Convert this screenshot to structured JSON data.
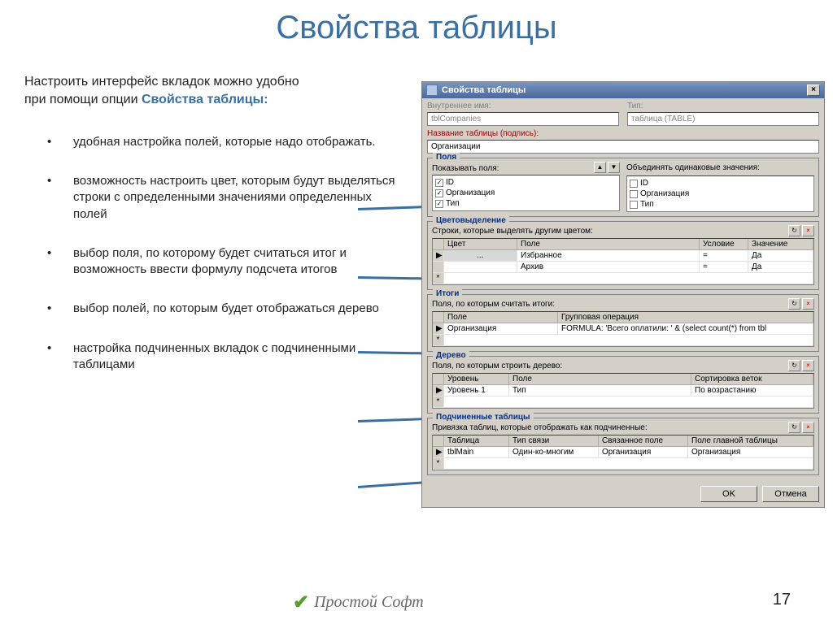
{
  "slide": {
    "title": "Свойства таблицы",
    "intro_line1": "Настроить интерфейс вкладок можно удобно",
    "intro_line2_prefix": "при помощи опции ",
    "intro_line2_em": "Свойства таблицы:",
    "bullets": [
      "удобная настройка полей, которые надо отображать.",
      "возможность настроить цвет, которым будут выделяться строки с определенными значениями определенных полей",
      "выбор поля, по которому будет считаться итог и возможность ввести формулу подсчета итогов",
      "выбор полей, по которым будет отображаться дерево",
      "настройка подчиненных вкладок с подчиненными таблицами"
    ],
    "page_number": "17",
    "footer": "Простой Софт"
  },
  "dialog": {
    "title": "Свойства таблицы",
    "close": "×",
    "internal_name_label": "Внутреннее имя:",
    "internal_name_value": "tblCompanies",
    "type_label": "Тип:",
    "type_value": "таблица (TABLE)",
    "caption_label": "Название таблицы (подпись):",
    "caption_value": "Организации",
    "groups": {
      "fields": {
        "title": "Поля",
        "show_label": "Показывать поля:",
        "merge_label": "Объединять одинаковые значения:",
        "show_items": [
          {
            "checked": true,
            "label": "ID"
          },
          {
            "checked": true,
            "label": "Организация"
          },
          {
            "checked": true,
            "label": "Тип"
          }
        ],
        "merge_items": [
          {
            "checked": false,
            "label": "ID"
          },
          {
            "checked": false,
            "label": "Организация"
          },
          {
            "checked": false,
            "label": "Тип"
          }
        ]
      },
      "colors": {
        "title": "Цветовыделение",
        "label": "Строки, которые выделять другим цветом:",
        "cols": [
          "Цвет",
          "Поле",
          "Условие",
          "Значение"
        ],
        "rows": [
          [
            "",
            "Избранное",
            "=",
            "Да"
          ],
          [
            "",
            "Архив",
            "=",
            "Да"
          ]
        ]
      },
      "totals": {
        "title": "Итоги",
        "label": "Поля, по которым считать итоги:",
        "cols": [
          "Поле",
          "Групповая операция"
        ],
        "rows": [
          [
            "Организация",
            "FORMULA: 'Всего оплатили: ' & (select count(*) from tbl"
          ]
        ]
      },
      "tree": {
        "title": "Дерево",
        "label": "Поля, по которым строить дерево:",
        "cols": [
          "Уровень",
          "Поле",
          "Сортировка веток"
        ],
        "rows": [
          [
            "Уровень 1",
            "Тип",
            "По возрастанию"
          ]
        ]
      },
      "subtables": {
        "title": "Подчиненные таблицы",
        "label": "Привязка таблиц, которые отображать как подчиненные:",
        "cols": [
          "Таблица",
          "Тип связи",
          "Связанное поле",
          "Поле главной таблицы"
        ],
        "rows": [
          [
            "tblMain",
            "Один-ко-многим",
            "Организация",
            "Организация"
          ]
        ]
      }
    },
    "btn_ok": "OK",
    "btn_cancel": "Отмена"
  }
}
